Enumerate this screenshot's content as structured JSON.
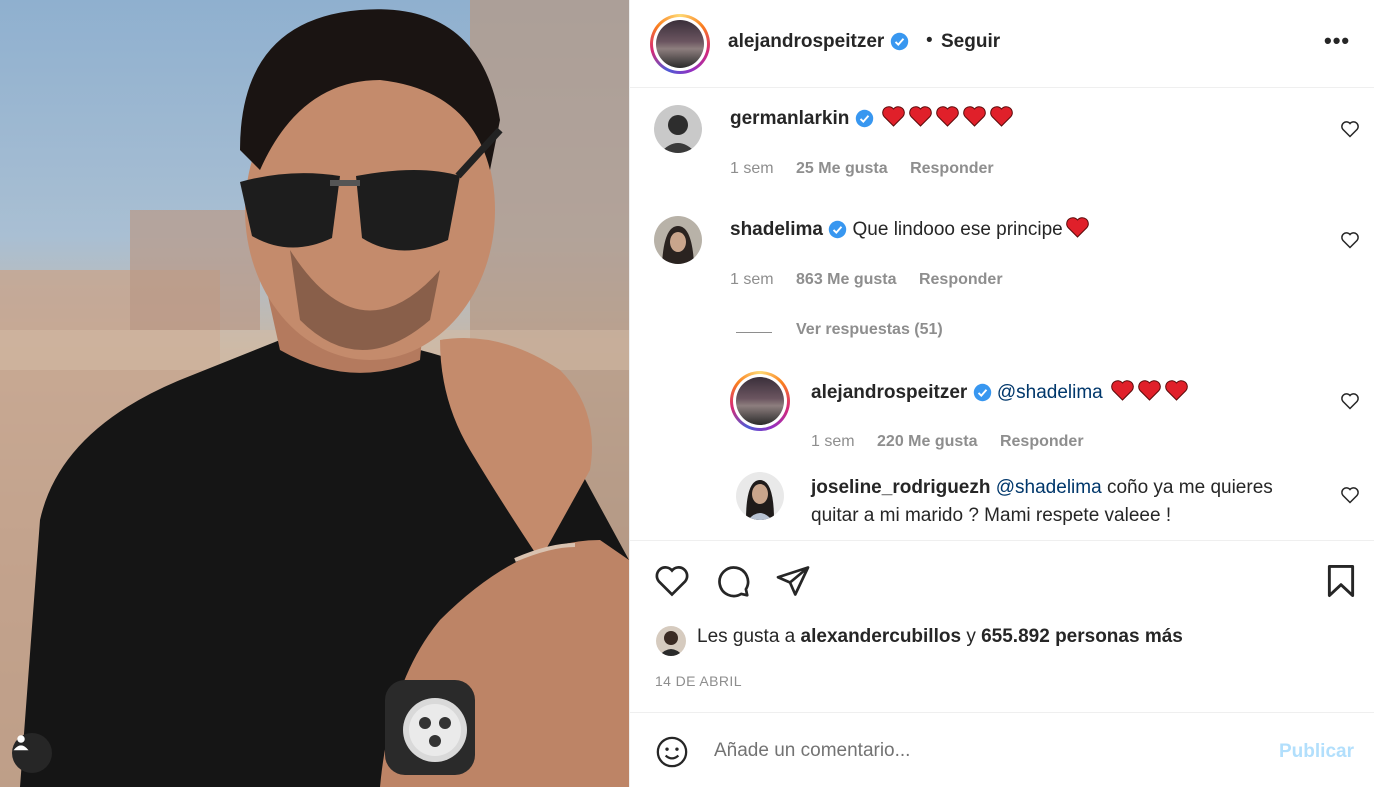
{
  "post": {
    "author": "alejandrospeitzer",
    "follow_label": "Seguir",
    "separator": "•",
    "more_label": "•••"
  },
  "comments": [
    {
      "user": "germanlarkin",
      "text": "",
      "hearts": 5,
      "time": "1 sem",
      "likes": "25 Me gusta",
      "reply": "Responder"
    },
    {
      "user": "shadelima",
      "text": "Que lindooo ese principe",
      "hearts": 1,
      "time": "1 sem",
      "likes": "863 Me gusta",
      "reply": "Responder",
      "view_replies": "Ver respuestas (51)"
    },
    {
      "user": "alejandrospeitzer",
      "mention": "@shadelima",
      "text": "",
      "hearts": 3,
      "time": "1 sem",
      "likes": "220 Me gusta",
      "reply": "Responder"
    },
    {
      "user": "joseline_rodriguezh",
      "mention": "@shadelima",
      "text_line1": "coño ya me quieres",
      "text_line2": "quitar a mi marido ? Mami respete valeee !"
    }
  ],
  "likes_summary": {
    "prefix": "Les gusta a",
    "user": "alexandercubillos",
    "connector": "y",
    "count": "655.892 personas más"
  },
  "date": "14 DE ABRIL",
  "composer": {
    "placeholder": "Añade un comentario...",
    "publish_label": "Publicar"
  },
  "colors": {
    "verified": "#3897f0",
    "heart": "#ed4956",
    "mention": "#00376b",
    "publish_disabled": "#b2dffc"
  }
}
